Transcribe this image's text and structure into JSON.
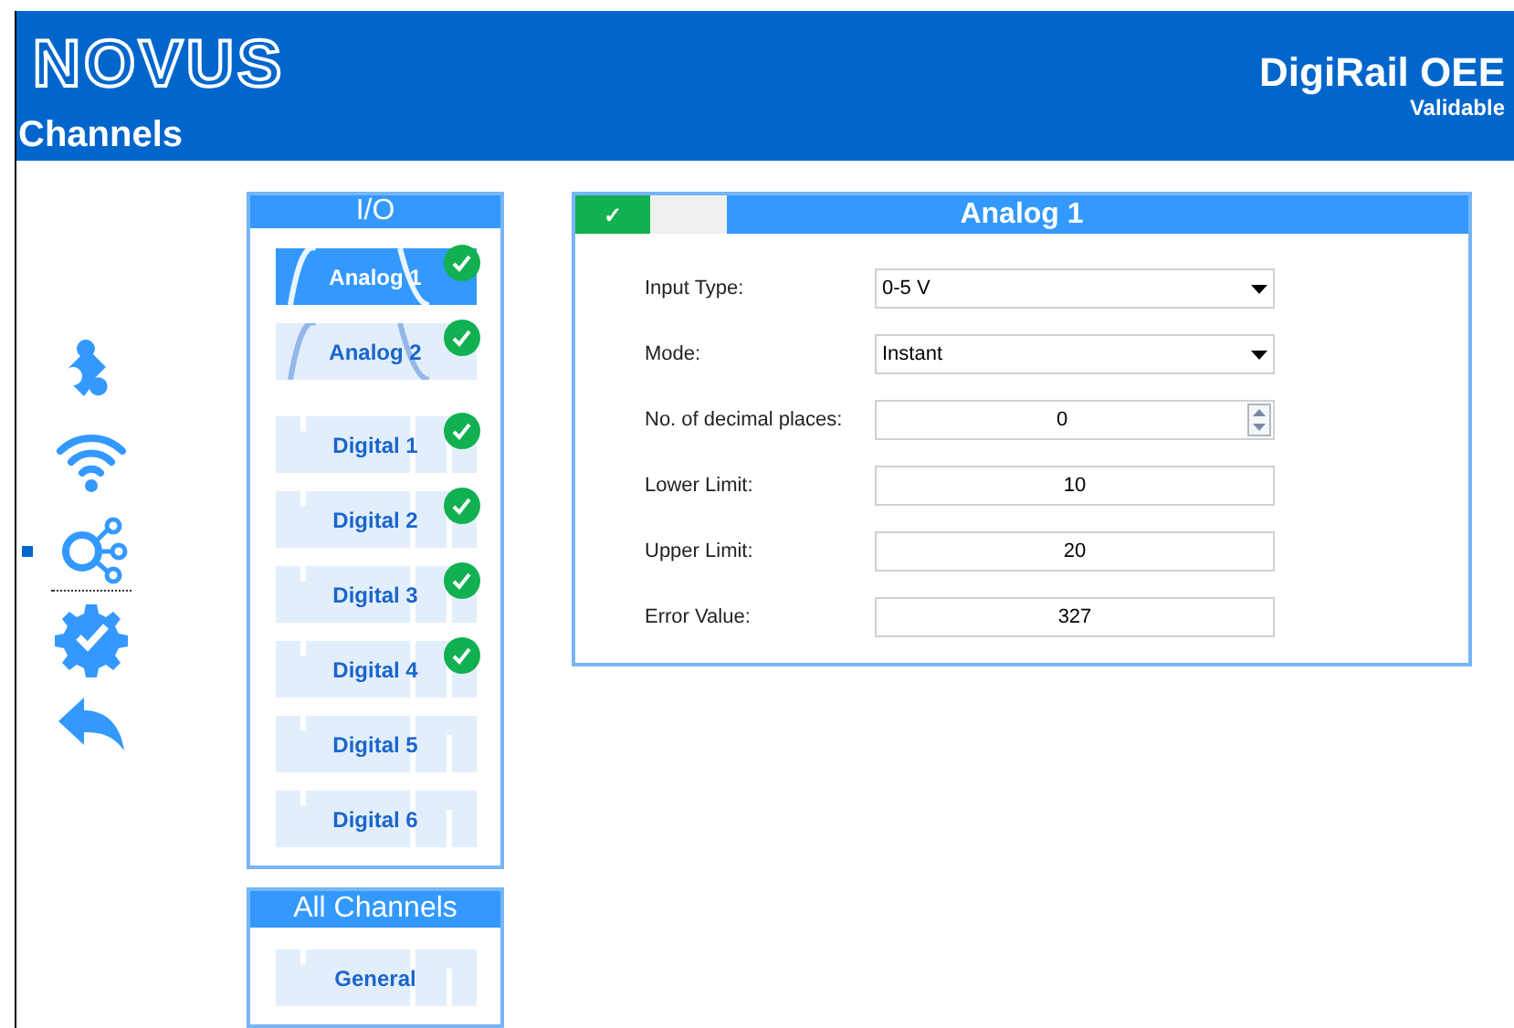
{
  "header": {
    "logo": "NOVUS",
    "section": "Channels",
    "product": "DigiRail OEE",
    "status": "Validable"
  },
  "nav": [
    {
      "kind": "puzzle",
      "selected": false
    },
    {
      "kind": "wifi",
      "selected": false
    },
    {
      "kind": "channels",
      "selected": true
    },
    {
      "kind": "gear",
      "selected": false
    },
    {
      "kind": "back",
      "selected": false
    }
  ],
  "io": {
    "title": "I/O",
    "items": [
      {
        "label": "Analog 1",
        "kind": "analog",
        "selected": true,
        "checked": true
      },
      {
        "label": "Analog 2",
        "kind": "analog",
        "selected": false,
        "checked": true
      },
      {
        "label": "Digital 1",
        "kind": "digital",
        "selected": false,
        "checked": true
      },
      {
        "label": "Digital 2",
        "kind": "digital",
        "selected": false,
        "checked": true
      },
      {
        "label": "Digital 3",
        "kind": "digital",
        "selected": false,
        "checked": true
      },
      {
        "label": "Digital 4",
        "kind": "digital",
        "selected": false,
        "checked": true
      },
      {
        "label": "Digital 5",
        "kind": "digital",
        "selected": false,
        "checked": false
      },
      {
        "label": "Digital 6",
        "kind": "digital",
        "selected": false,
        "checked": false
      }
    ]
  },
  "all_channels": {
    "title": "All Channels",
    "items": [
      {
        "label": "General",
        "kind": "digital",
        "selected": false,
        "checked": false
      }
    ]
  },
  "form": {
    "title": "Analog 1",
    "enabled": true,
    "enabled_mark": "✓",
    "fields": [
      {
        "label": "Input Type:",
        "kind": "select",
        "value": "0-5 V"
      },
      {
        "label": "Mode:",
        "kind": "select",
        "value": "Instant"
      },
      {
        "label": "No. of decimal places:",
        "kind": "spinner",
        "value": "0"
      },
      {
        "label": "Lower Limit:",
        "kind": "text",
        "value": "10"
      },
      {
        "label": "Upper Limit:",
        "kind": "text",
        "value": "20"
      },
      {
        "label": "Error Value:",
        "kind": "text",
        "value": "327"
      }
    ]
  }
}
